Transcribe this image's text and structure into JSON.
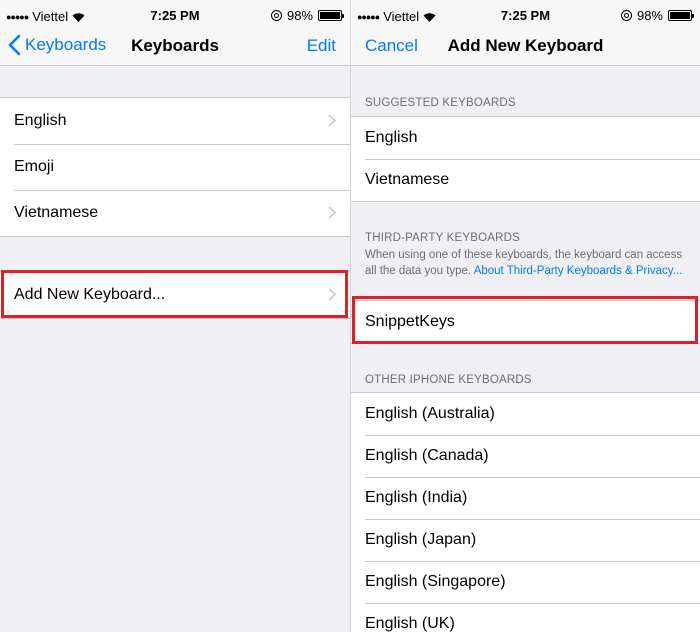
{
  "status_bar": {
    "carrier": "Viettel",
    "time": "7:25 PM",
    "battery": "98%",
    "battery_level": 0.98
  },
  "left": {
    "nav": {
      "back_label": "Keyboards",
      "title": "Keyboards",
      "right_label": "Edit"
    },
    "keyboards": [
      "English",
      "Emoji",
      "Vietnamese"
    ],
    "add_new": "Add New Keyboard..."
  },
  "right": {
    "nav": {
      "left_label": "Cancel",
      "title": "Add New Keyboard"
    },
    "suggested_header": "SUGGESTED KEYBOARDS",
    "suggested": [
      "English",
      "Vietnamese"
    ],
    "third_party_header": "THIRD-PARTY KEYBOARDS",
    "third_party_note": "When using one of these keyboards, the keyboard can access all the data you type.",
    "third_party_link": "About Third-Party Keyboards & Privacy...",
    "third_party": [
      "SnippetKeys"
    ],
    "other_header": "OTHER IPHONE KEYBOARDS",
    "other": [
      "English (Australia)",
      "English (Canada)",
      "English (India)",
      "English (Japan)",
      "English (Singapore)",
      "English (UK)"
    ]
  },
  "colors": {
    "accent": "#007aff",
    "highlight": "#e02027",
    "background": "#efeff4"
  }
}
